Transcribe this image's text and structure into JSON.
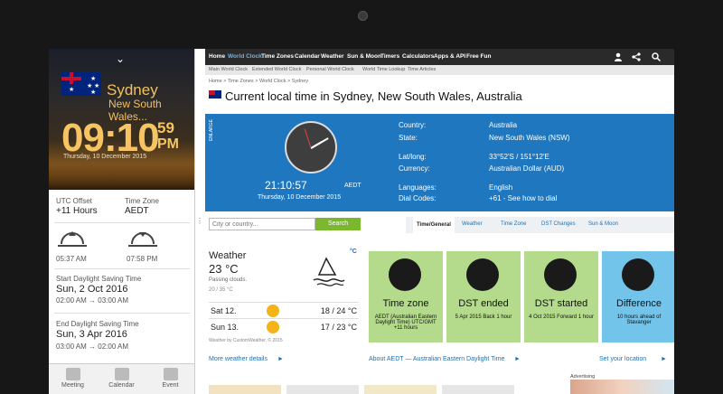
{
  "sidebar": {
    "city": "Sydney",
    "region": "New South Wales...",
    "time_hm": "09:10",
    "time_sec": "59",
    "time_ampm": "PM",
    "date": "Thursday, 10 December 2015",
    "utc_offset_label": "UTC Offset",
    "utc_offset_value": "+11 Hours",
    "tz_label": "Time Zone",
    "tz_value": "AEDT",
    "sunrise": "05:37 AM",
    "sunset": "07:58 PM",
    "start_dst_label": "Start Daylight Saving Time",
    "start_dst_date": "Sun, 2 Oct 2016",
    "start_dst_times": "02:00 AM → 03:00 AM",
    "end_dst_label": "End Daylight Saving Time",
    "end_dst_date": "Sun, 3 Apr 2016",
    "end_dst_times": "03:00 AM → 02:00 AM",
    "tabs": [
      "Meeting",
      "Calendar",
      "Event"
    ]
  },
  "topnav": [
    "Home",
    "World Clock",
    "Time Zones",
    "Calendar",
    "Weather",
    "Sun & Moon",
    "Timers",
    "Calculators",
    "Apps & API",
    "Free Fun"
  ],
  "subnav": [
    "Main World Clock",
    "Extended World Clock",
    "Personal World Clock",
    "World Time Lookup",
    "Time Articles"
  ],
  "breadcrumb": "Home > Time Zones > World Clock > Sydney",
  "page_title": "Current local time in Sydney, New South Wales, Australia",
  "enlarge": "ENLARGE",
  "clock": {
    "time": "21:10:57",
    "tz": "AEDT",
    "date": "Thursday, 10 December 2015"
  },
  "info": {
    "country_label": "Country:",
    "country": "Australia",
    "state_label": "State:",
    "state": "New South Wales (NSW)",
    "latlong_label": "Lat/long:",
    "latlong": "33°52'S / 151°12'E",
    "currency_label": "Currency:",
    "currency": "Australian Dollar (AUD)",
    "languages_label": "Languages:",
    "languages": "English",
    "dialcodes_label": "Dial Codes:",
    "dialcodes": "+61 - See how to dial"
  },
  "search": {
    "placeholder": "City or country...",
    "button": "Search"
  },
  "tabs": [
    "Time/General",
    "Weather",
    "Time Zone",
    "DST Changes",
    "Sun & Moon"
  ],
  "weather": {
    "title": "Weather",
    "temp": "23 °C",
    "unit_toggle": "°C",
    "desc": "Passing clouds.",
    "range": "20 / 35 °C",
    "forecast": [
      {
        "day": "Sat 12.",
        "temps": "18 / 24 °C"
      },
      {
        "day": "Sun 13.",
        "temps": "17 / 23 °C"
      }
    ],
    "source": "Weather by CustomWeather, © 2015",
    "more_link": "More weather details"
  },
  "cards": [
    {
      "title": "Time zone",
      "sub": "AEDT (Australian Eastern Daylight Time) UTC/GMT +11 hours",
      "color": "#b4da8c"
    },
    {
      "title": "DST ended",
      "sub": "5 Apr 2015 Back 1 hour",
      "color": "#b4da8c"
    },
    {
      "title": "DST started",
      "sub": "4 Oct 2015 Forward 1 hour",
      "color": "#b4da8c"
    },
    {
      "title": "Difference",
      "sub": "10 hours ahead of Stavanger",
      "color": "#73c4ea"
    }
  ],
  "about_link": "About AEDT — Australian Eastern Daylight Time",
  "location_link": "Set your location",
  "advertising": "Advertising",
  "colors": {
    "band": "#1f77bf",
    "nav": "#2a2a2a",
    "search_button": "#7cb82f",
    "link": "#1f6fb2"
  }
}
